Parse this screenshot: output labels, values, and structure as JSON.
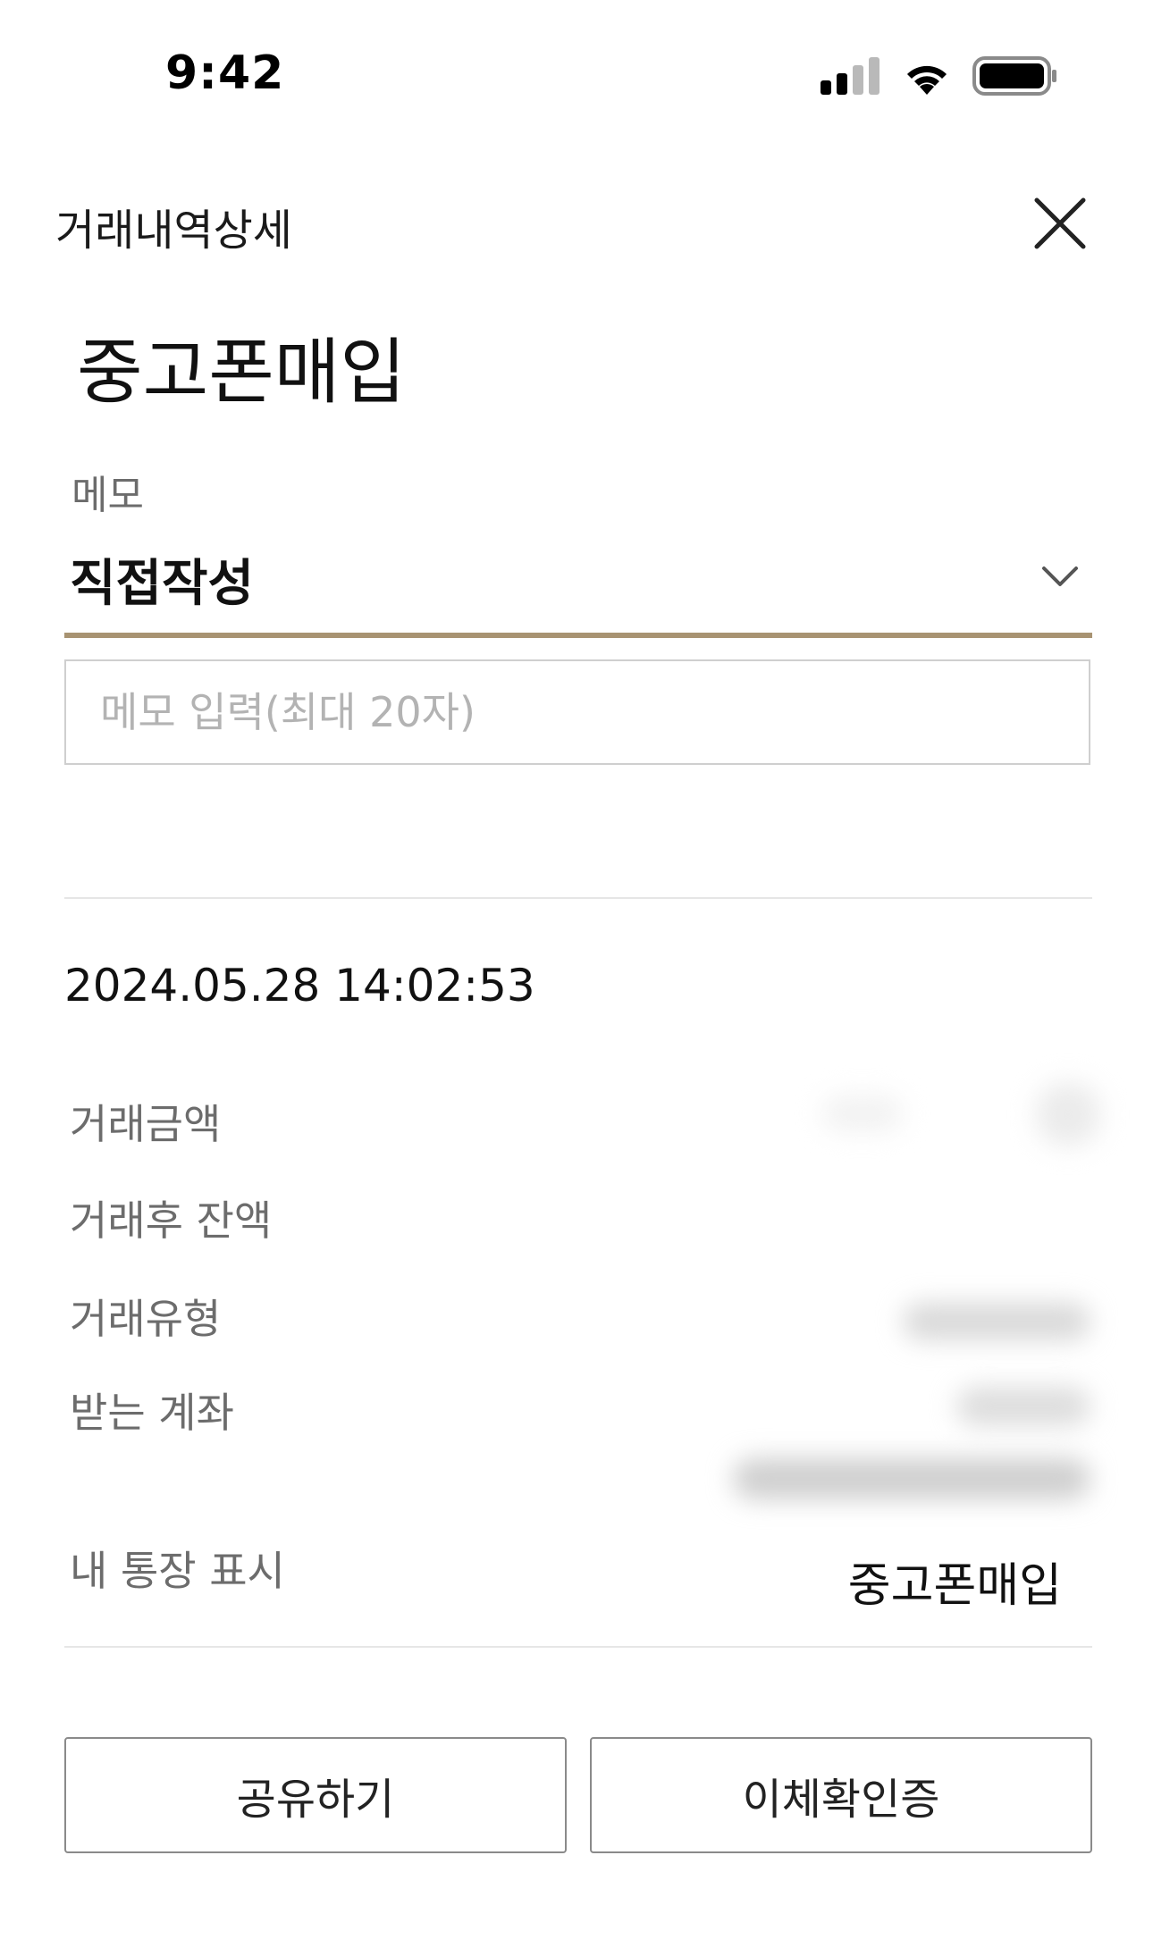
{
  "status_bar": {
    "time": "9:42"
  },
  "header": {
    "title": "거래내역상세",
    "close_icon": "close-icon"
  },
  "main_title": "중고폰매입",
  "memo": {
    "label": "메모",
    "selected_option": "직접작성",
    "input_placeholder": "메모 입력(최대 20자)",
    "input_value": ""
  },
  "transaction": {
    "datetime": "2024.05.28 14:02:53",
    "rows": [
      {
        "label": "거래금액"
      },
      {
        "label": "거래후 잔액"
      },
      {
        "label": "거래유형"
      },
      {
        "label": "받는 계좌"
      },
      {
        "label": "내 통장 표시",
        "value": "중고폰매입"
      }
    ]
  },
  "buttons": {
    "share": "공유하기",
    "transfer_certificate": "이체확인증"
  },
  "colors": {
    "accent_underline": "#a89372",
    "label_gray": "#6c6c6c",
    "placeholder_gray": "#b3b3b3",
    "border_gray": "#cfcfcf"
  }
}
